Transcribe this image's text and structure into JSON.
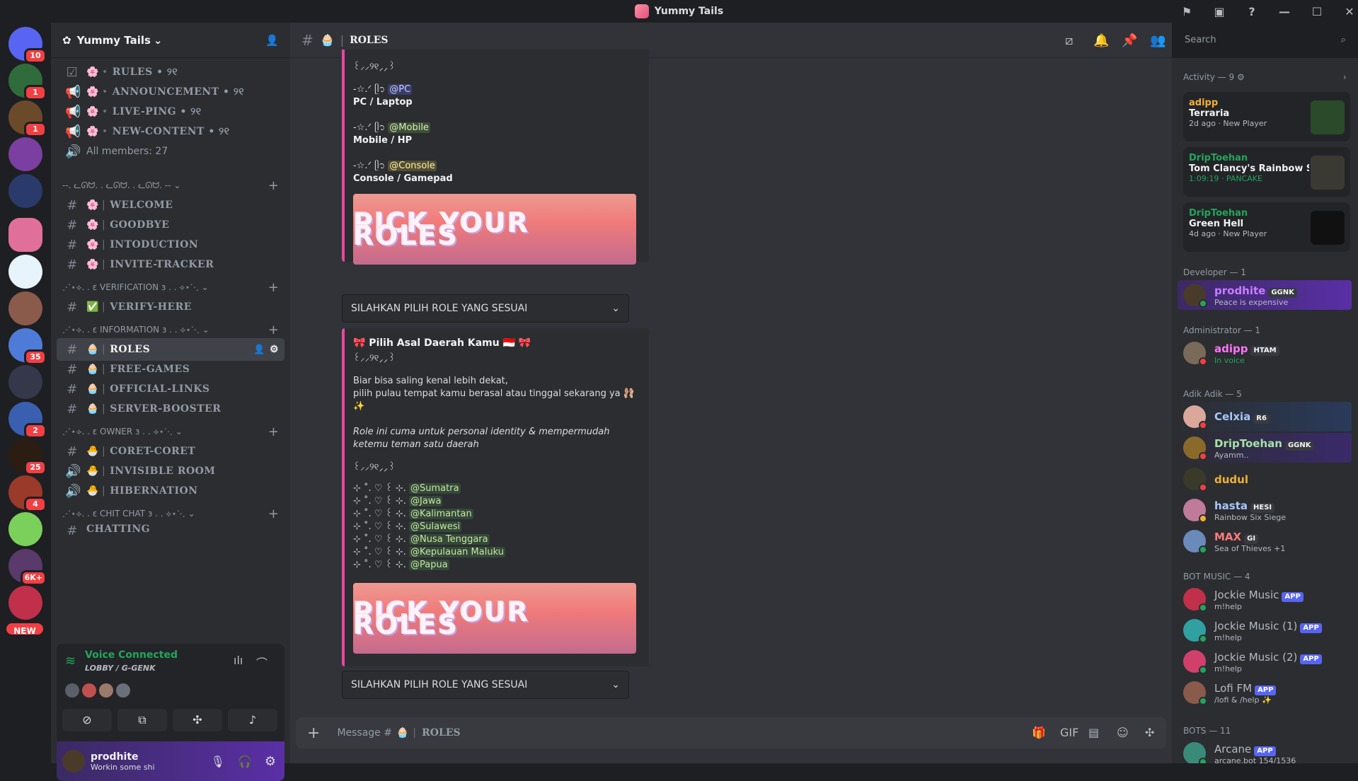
{
  "window": {
    "title": "Yummy Tails"
  },
  "servers": [
    {
      "badge": "10"
    },
    {
      "badge": "1"
    },
    {
      "badge": "1"
    },
    {
      "badge": ""
    },
    {
      "badge": ""
    },
    {
      "badge": ""
    },
    {
      "badge": ""
    },
    {
      "badge": ""
    },
    {
      "badge": "35"
    },
    {
      "badge": ""
    },
    {
      "badge": "2"
    },
    {
      "badge": "25"
    },
    {
      "badge": "4"
    },
    {
      "badge": ""
    },
    {
      "badge": "6K+"
    },
    {
      "badge": ""
    }
  ],
  "servers_new": "NEW",
  "guild": {
    "name": "Yummy Tails"
  },
  "channels": {
    "top": [
      {
        "name": "RULES • ୨୧",
        "emoji": "🌸",
        "icon": "☑"
      },
      {
        "name": "ANNOUNCEMENT • ୨୧",
        "emoji": "🌸",
        "icon": "📢"
      },
      {
        "name": "LIVE-PING • ୨୧",
        "emoji": "🌸",
        "icon": "📢"
      },
      {
        "name": "NEW-CONTENT • ୨୧",
        "emoji": "🌸",
        "icon": "📢"
      }
    ],
    "members_count": "All members: 27",
    "cat1": "--. ᓚᘏᗢ. . ᓚᘏᗢ. . ᓚᘏᗢ. -- ⌄",
    "group1": [
      {
        "name": "WELCOME",
        "emoji": "🌸"
      },
      {
        "name": "GOODBYE",
        "emoji": "🌸"
      },
      {
        "name": "INTODUCTION",
        "emoji": "🌸"
      },
      {
        "name": "INVITE-TRACKER",
        "emoji": "🌸"
      }
    ],
    "cat2": "⋰⋆⟡. . ε VERIFICATION ɜ . . ⟡⋆⋱ ⌄",
    "group2": [
      {
        "name": "VERIFY-HERE",
        "emoji": "✅"
      }
    ],
    "cat3": "⋰⋆⟡. . ε INFORMATION ɜ . . ⟡⋆⋱ ⌄",
    "group3": [
      {
        "name": "ROLES",
        "emoji": "🧁"
      },
      {
        "name": "FREE-GAMES",
        "emoji": "🧁"
      },
      {
        "name": "OFFICIAL-LINKS",
        "emoji": "🧁"
      },
      {
        "name": "SERVER-BOOSTER",
        "emoji": "🧁"
      }
    ],
    "cat4": "⋰⋆⟡. . ε OWNER ɜ . . ⟡⋆⋱ ⌄",
    "group4": [
      {
        "name": "CORET-CORET",
        "emoji": "🐣",
        "icon": "#"
      },
      {
        "name": "INVISIBLE ROOM",
        "emoji": "🐣",
        "icon": "🔊"
      },
      {
        "name": "HIBERNATION",
        "emoji": "🐣",
        "icon": "🔊"
      }
    ],
    "cat5": "⋰⋆⟡. . ε CHIT CHAT ɜ . . ⟡⋆⋱ ⌄",
    "partial": "CHATTING"
  },
  "voice": {
    "status": "Voice Connected",
    "location": "LOBBY / G-GENK"
  },
  "user": {
    "name": "prodhite",
    "status": "Workin some shi"
  },
  "header": {
    "channel": "ROLES",
    "emoji": "🧁",
    "search_placeholder": "Search"
  },
  "embed1": {
    "deco": "꒰⸝⸝୨୧⸝⸝꒱",
    "lines": [
      {
        "prefix": "-☆.ᐟ ᥫ᭡",
        "mention": "@PC",
        "label": "PC / Laptop"
      },
      {
        "prefix": "-☆.ᐟ ᥫ᭡",
        "mention": "@Mobile",
        "label": "Mobile / HP"
      },
      {
        "prefix": "-☆.ᐟ ᥫ᭡",
        "mention": "@Console",
        "label": "Console / Gamepad"
      }
    ],
    "banner": "PICK YOUR ROLES",
    "select": "SILAHKAN PILIH ROLE YANG SESUAI"
  },
  "embed2": {
    "title": "🎀 Pilih Asal Daerah Kamu 🇮🇩 🎀",
    "deco": "꒰⸝⸝୨୧⸝⸝꒱",
    "p1": "Biar bisa saling kenal lebih dekat,",
    "p2": "pilih pulau tempat kamu berasal atau tinggal sekarang ya 🩰✨",
    "italic": "Role ini cuma untuk personal identity & mempermudah ketemu teman satu daerah",
    "deco2": "꒰⸝⸝୨୧⸝⸝꒱",
    "regions": [
      {
        "prefix": "⊹ ˚. ♡ ꒰ ⊹.",
        "mention": "@Sumatra"
      },
      {
        "prefix": "⊹ ˚. ♡ ꒰ ⊹.",
        "mention": "@Jawa"
      },
      {
        "prefix": "⊹ ˚. ♡ ꒰ ⊹.",
        "mention": "@Kalimantan"
      },
      {
        "prefix": "⊹ ˚. ♡ ꒰ ⊹.",
        "mention": "@Sulawesi"
      },
      {
        "prefix": "⊹ ˚. ♡ ꒰ ⊹.",
        "mention": "@Nusa Tenggara"
      },
      {
        "prefix": "⊹ ˚. ♡ ꒰ ⊹.",
        "mention": "@Kepulauan Maluku"
      },
      {
        "prefix": "⊹ ˚. ♡ ꒰ ⊹.",
        "mention": "@Papua"
      }
    ],
    "banner": "PICK YOUR ROLES",
    "select": "SILAHKAN PILIH ROLE YANG SESUAI"
  },
  "composer": {
    "placeholder": "Message #",
    "channel": "ROLES"
  },
  "members": {
    "activity_header": "Activity — 9",
    "activities": [
      {
        "user": "adipp",
        "game": "Terraria",
        "meta": "2d ago · New Player"
      },
      {
        "user": "DripToehan",
        "game": "Tom Clancy's Rainbow Six ...",
        "meta": "1:09:19 · PANCAKE"
      },
      {
        "user": "DripToehan",
        "game": "Green Hell",
        "meta": "4d ago · New Player"
      }
    ],
    "groups": [
      {
        "header": "Developer — 1",
        "items": [
          {
            "name": "prodhite",
            "tag": "GGNK",
            "sub": "Peace is expensive",
            "color": "#c77dff",
            "app": ""
          }
        ]
      },
      {
        "header": "Administrator — 1",
        "items": [
          {
            "name": "adipp",
            "tag": "HTAM",
            "sub": "In voice",
            "color": "#ff73fa",
            "app": ""
          }
        ]
      },
      {
        "header": "Adik Adik — 5",
        "items": [
          {
            "name": "Celxia",
            "tag": "R6",
            "sub": "",
            "color": "#a8c7fa",
            "app": ""
          },
          {
            "name": "DripToehan",
            "tag": "GGNK",
            "sub": "Ayamm..",
            "color": "#a3e4a3",
            "app": ""
          },
          {
            "name": "dudul",
            "tag": "",
            "sub": "",
            "color": "#f0b232",
            "app": ""
          },
          {
            "name": "hasta",
            "tag": "HESI",
            "sub": "Rainbow Six Siege",
            "color": "#a8c7fa",
            "app": ""
          },
          {
            "name": "MAX",
            "tag": "GI",
            "sub": "Sea of Thieves +1",
            "color": "#ff7b7b",
            "app": ""
          }
        ]
      },
      {
        "header": "BOT MUSIC — 4",
        "items": [
          {
            "name": "Jockie Music",
            "tag": "",
            "sub": "m!help",
            "color": "#b5bac1",
            "app": "APP"
          },
          {
            "name": "Jockie Music (1)",
            "tag": "",
            "sub": "m!help",
            "color": "#b5bac1",
            "app": "APP"
          },
          {
            "name": "Jockie Music (2)",
            "tag": "",
            "sub": "m!help",
            "color": "#b5bac1",
            "app": "APP"
          },
          {
            "name": "Lofi FM",
            "tag": "",
            "sub": "/lofi & /help ✨",
            "color": "#b5bac1",
            "app": "APP"
          }
        ]
      },
      {
        "header": "BOTS — 11",
        "items": [
          {
            "name": "Arcane",
            "tag": "",
            "sub": "arcane.bot 154/1536",
            "color": "#b5bac1",
            "app": "APP"
          }
        ]
      }
    ]
  }
}
